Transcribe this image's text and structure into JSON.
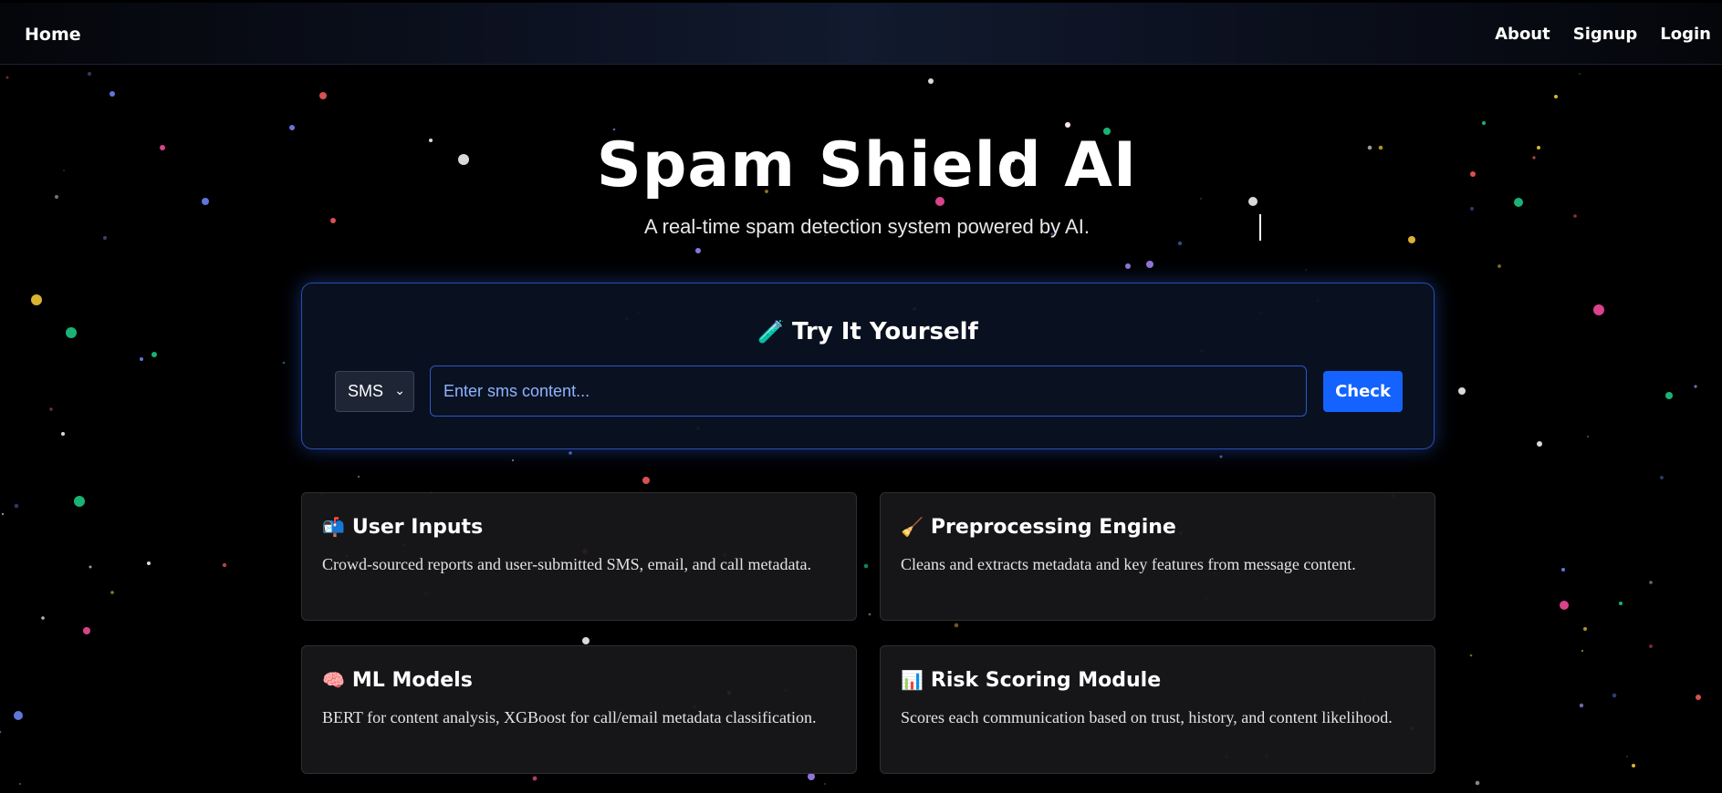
{
  "nav": {
    "home": "Home",
    "links": [
      "About",
      "Signup",
      "Login"
    ]
  },
  "hero": {
    "title": "Spam Shield AI",
    "subtitle": "A real-time spam detection system powered by AI."
  },
  "try_it": {
    "icon": "test-tube-icon",
    "icon_glyph": "🧪",
    "title": "Try It Yourself",
    "type_select": {
      "selected": "SMS"
    },
    "input_placeholder": "Enter sms content...",
    "check_label": "Check"
  },
  "features": [
    {
      "icon": "mailbox-icon",
      "icon_glyph": "📬",
      "title": "User Inputs",
      "description": "Crowd-sourced reports and user-submitted SMS, email, and call metadata."
    },
    {
      "icon": "broom-icon",
      "icon_glyph": "🧹",
      "title": "Preprocessing Engine",
      "description": "Cleans and extracts metadata and key features from message content."
    },
    {
      "icon": "brain-icon",
      "icon_glyph": "🧠",
      "title": "ML Models",
      "description": "BERT for content analysis, XGBoost for call/email metadata classification."
    },
    {
      "icon": "bar-chart-icon",
      "icon_glyph": "📊",
      "title": "Risk Scoring Module",
      "description": "Scores each communication based on trust, history, and content likelihood."
    }
  ],
  "colors": {
    "background": "#000000",
    "accent": "#1463ff",
    "card_border": "#2a4db3",
    "particle_palette": [
      "#ff5e5e",
      "#6e8cff",
      "#1fd18a",
      "#ffd23a",
      "#ff4fa3",
      "#ffffff",
      "#a78bfa"
    ]
  }
}
